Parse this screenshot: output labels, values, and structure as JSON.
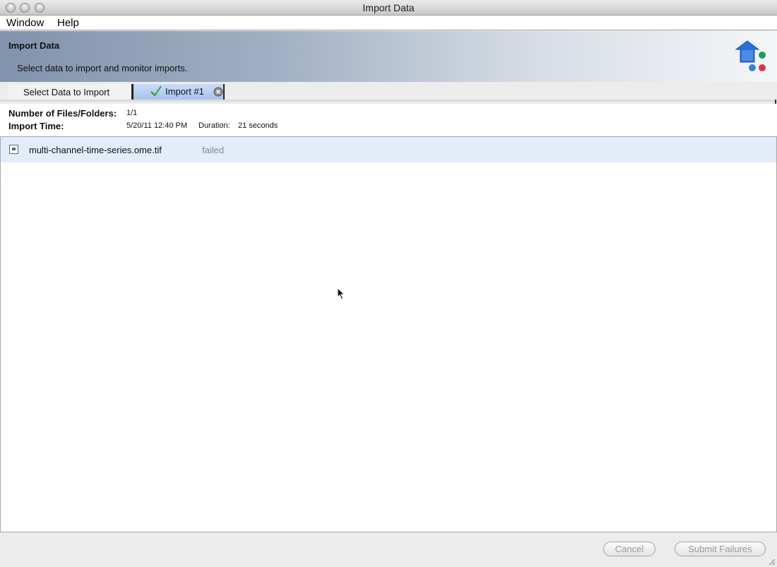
{
  "window": {
    "title": "Import Data"
  },
  "menubar": {
    "items": [
      "Window",
      "Help"
    ]
  },
  "banner": {
    "title": "Import Data",
    "subtitle": "Select data to import and monitor imports."
  },
  "tabs": [
    {
      "label": "Select Data to Import",
      "active": false
    },
    {
      "label": "Import #1",
      "active": true,
      "status_icon": "checkmark-icon",
      "close_icon": "close-icon"
    }
  ],
  "summary": {
    "files_label": "Number of Files/Folders:",
    "files_value": "1/1",
    "time_label": "Import Time:",
    "time_value": "5/20/11 12:40 PM",
    "duration_label": "Duration:",
    "duration_value": "21 seconds"
  },
  "files": [
    {
      "name": "multi-channel-time-series.ome.tif",
      "status": "failed",
      "icon": "image-file-icon"
    }
  ],
  "footer": {
    "cancel_label": "Cancel",
    "submit_label": "Submit Failures"
  },
  "colors": {
    "row_highlight": "#e3ecf9",
    "tab_active": "#a8c3ee",
    "logo_blue": "#2a6fd6",
    "logo_green": "#1f9a5e",
    "logo_red": "#d9334b"
  }
}
